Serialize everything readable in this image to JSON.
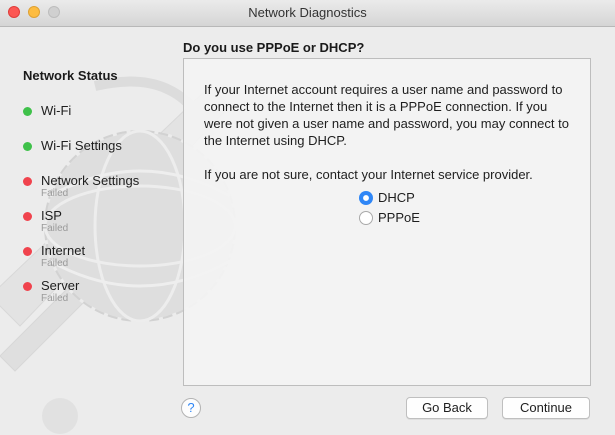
{
  "window": {
    "title": "Network Diagnostics"
  },
  "sidebar": {
    "title": "Network Status",
    "items": [
      {
        "label": "Wi-Fi",
        "status": "ok",
        "sub": ""
      },
      {
        "label": "Wi-Fi Settings",
        "status": "ok",
        "sub": ""
      },
      {
        "label": "Network Settings",
        "status": "failed",
        "sub": "Failed"
      },
      {
        "label": "ISP",
        "status": "failed",
        "sub": "Failed"
      },
      {
        "label": "Internet",
        "status": "failed",
        "sub": "Failed"
      },
      {
        "label": "Server",
        "status": "failed",
        "sub": "Failed"
      }
    ]
  },
  "main": {
    "heading": "Do you use PPPoE or DHCP?",
    "paragraph1": "If your Internet account requires a user name and password to connect to the Internet then it is a PPPoE connection. If you were not given a user name and password, you may connect to the Internet using DHCP.",
    "paragraph2": "If you are not sure, contact your Internet service provider.",
    "options": [
      {
        "label": "DHCP",
        "selected": true
      },
      {
        "label": "PPPoE",
        "selected": false
      }
    ]
  },
  "footer": {
    "help_label": "?",
    "back_label": "Go Back",
    "continue_label": "Continue"
  },
  "colors": {
    "status_ok": "#3fc14a",
    "status_failed": "#f0434d",
    "accent": "#2f86f6"
  }
}
